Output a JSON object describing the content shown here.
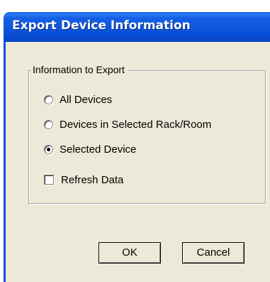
{
  "window": {
    "title": "Export Device Information"
  },
  "group": {
    "label": "Information to Export",
    "options": [
      {
        "label": "All Devices",
        "selected": false
      },
      {
        "label": "Devices in Selected Rack/Room",
        "selected": false
      },
      {
        "label": "Selected Device",
        "selected": true
      }
    ],
    "refresh": {
      "label": "Refresh Data",
      "checked": false
    }
  },
  "buttons": {
    "ok": "OK",
    "cancel": "Cancel"
  },
  "colors": {
    "titlebar": "#0a50d8",
    "dialog_bg": "#ece9d8"
  }
}
